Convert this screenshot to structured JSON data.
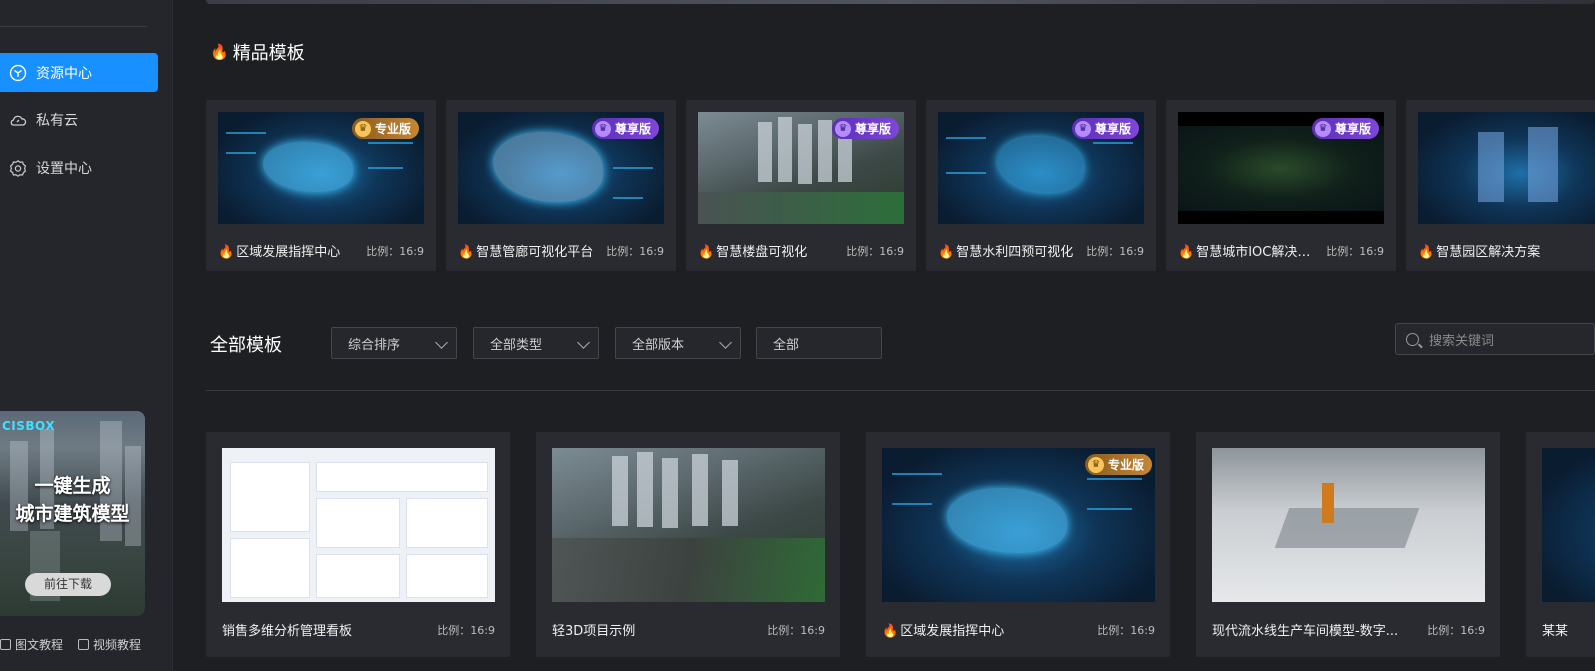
{
  "sidebar": {
    "items": [
      {
        "label": "资源中心",
        "icon": "cube-icon",
        "active": true
      },
      {
        "label": "私有云",
        "icon": "cloud-icon",
        "active": false
      },
      {
        "label": "设置中心",
        "icon": "gear-icon",
        "active": false
      }
    ],
    "promo": {
      "logo": "CISBOX",
      "line1": "一键生成",
      "line2": "城市建筑模型",
      "button": "前往下载"
    },
    "help": {
      "tutorial": "图文教程",
      "video": "视频教程"
    }
  },
  "featured": {
    "title": "精品模板",
    "cards": [
      {
        "name": "区域发展指挥中心",
        "ratio": "比例：16:9",
        "badge": "专业版",
        "tier": "pro"
      },
      {
        "name": "智慧管廊可视化平台",
        "ratio": "比例：16:9",
        "badge": "尊享版",
        "tier": "vip"
      },
      {
        "name": "智慧楼盘可视化",
        "ratio": "比例：16:9",
        "badge": "尊享版",
        "tier": "vip"
      },
      {
        "name": "智慧水利四预可视化",
        "ratio": "比例：16:9",
        "badge": "尊享版",
        "tier": "vip"
      },
      {
        "name": "智慧城市IOC解决方案",
        "ratio": "比例：16:9",
        "badge": "尊享版",
        "tier": "vip"
      },
      {
        "name": "智慧园区解决方案",
        "ratio": "",
        "badge": "",
        "tier": "vip"
      }
    ]
  },
  "all": {
    "title": "全部模板",
    "filters": [
      "综合排序",
      "全部类型",
      "全部版本",
      "全部"
    ],
    "search_placeholder": "搜索关键词",
    "cards": [
      {
        "name": "销售多维分析管理看板",
        "ratio": "比例：16:9",
        "badge": ""
      },
      {
        "name": "轻3D项目示例",
        "ratio": "比例：16:9",
        "badge": ""
      },
      {
        "name": "区域发展指挥中心",
        "ratio": "比例：16:9",
        "badge": "专业版"
      },
      {
        "name": "现代流水线生产车间模型-数字...",
        "ratio": "比例：16:9",
        "badge": ""
      },
      {
        "name": "某某",
        "ratio": "",
        "badge": ""
      }
    ]
  },
  "colors": {
    "accent": "#1890ff",
    "flame": "#ff5a1f",
    "pro": "#c48735",
    "vip": "#7f46d8"
  }
}
